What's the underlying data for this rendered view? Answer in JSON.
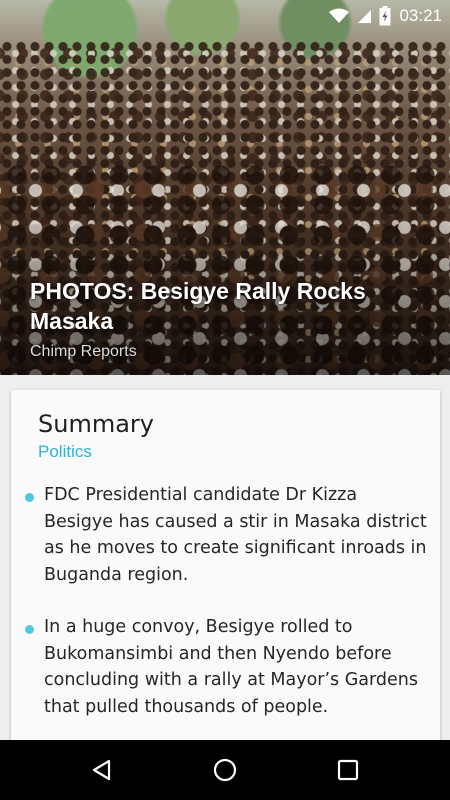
{
  "status_bar": {
    "time": "03:21",
    "icons": [
      "wifi-icon",
      "signal-icon",
      "battery-icon"
    ]
  },
  "article": {
    "title": "PHOTOS: Besigye Rally Rocks Masaka",
    "source": "Chimp Reports",
    "hero_image": "crowd-photo"
  },
  "summary": {
    "heading": "Summary",
    "category": "Politics",
    "bullets": [
      "FDC Presidential candidate Dr Kizza Besigye has caused a stir in Masaka district as he moves to create significant inroads in Buganda region.",
      "In a huge convoy, Besigye rolled to Bukomansimbi and then Nyendo before concluding with a rally at Mayor’s Gardens that pulled thousands of people."
    ]
  },
  "nav_bar": {
    "buttons": [
      "back-icon",
      "home-icon",
      "recents-icon"
    ]
  },
  "colors": {
    "accent": "#29b6d4",
    "bullet": "#4fc8e0",
    "card": "#fafafa",
    "nav": "#000000"
  }
}
